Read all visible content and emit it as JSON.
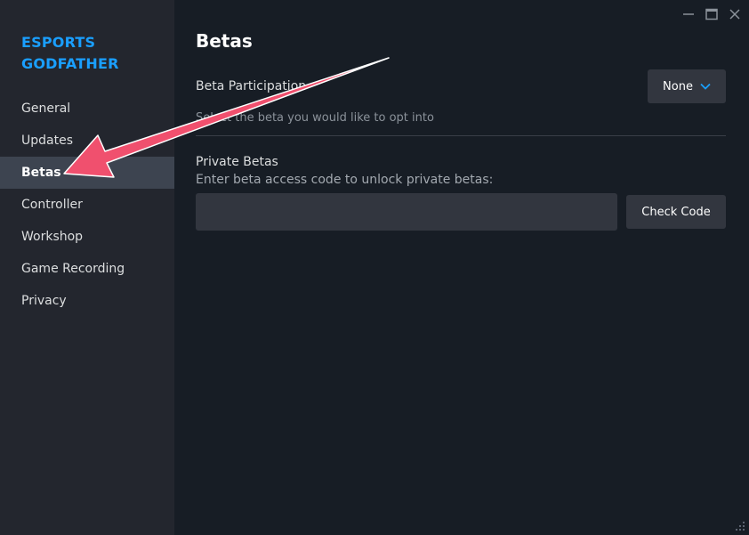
{
  "window": {
    "controls": {
      "minimize_icon": "minimize-icon",
      "maximize_icon": "maximize-icon",
      "close_icon": "close-icon"
    }
  },
  "sidebar": {
    "title": "ESPORTS GODFATHER",
    "active_index": 2,
    "items": [
      {
        "label": "General"
      },
      {
        "label": "Updates"
      },
      {
        "label": "Betas"
      },
      {
        "label": "Controller"
      },
      {
        "label": "Workshop"
      },
      {
        "label": "Game Recording"
      },
      {
        "label": "Privacy"
      }
    ]
  },
  "main": {
    "title": "Betas",
    "beta_participation": {
      "label": "Beta Participation",
      "description": "Select the beta you would like to opt into",
      "dropdown_value": "None"
    },
    "private_betas": {
      "label": "Private Betas",
      "description": "Enter beta access code to unlock private betas:",
      "input_value": "",
      "input_placeholder": "",
      "check_button_label": "Check Code"
    }
  },
  "colors": {
    "accent": "#1a9fff",
    "annotation_arrow": "#f0506e",
    "background": "#171d25",
    "sidebar": "#23262e",
    "active_item": "#3d4450",
    "control_bg": "#32363f"
  }
}
